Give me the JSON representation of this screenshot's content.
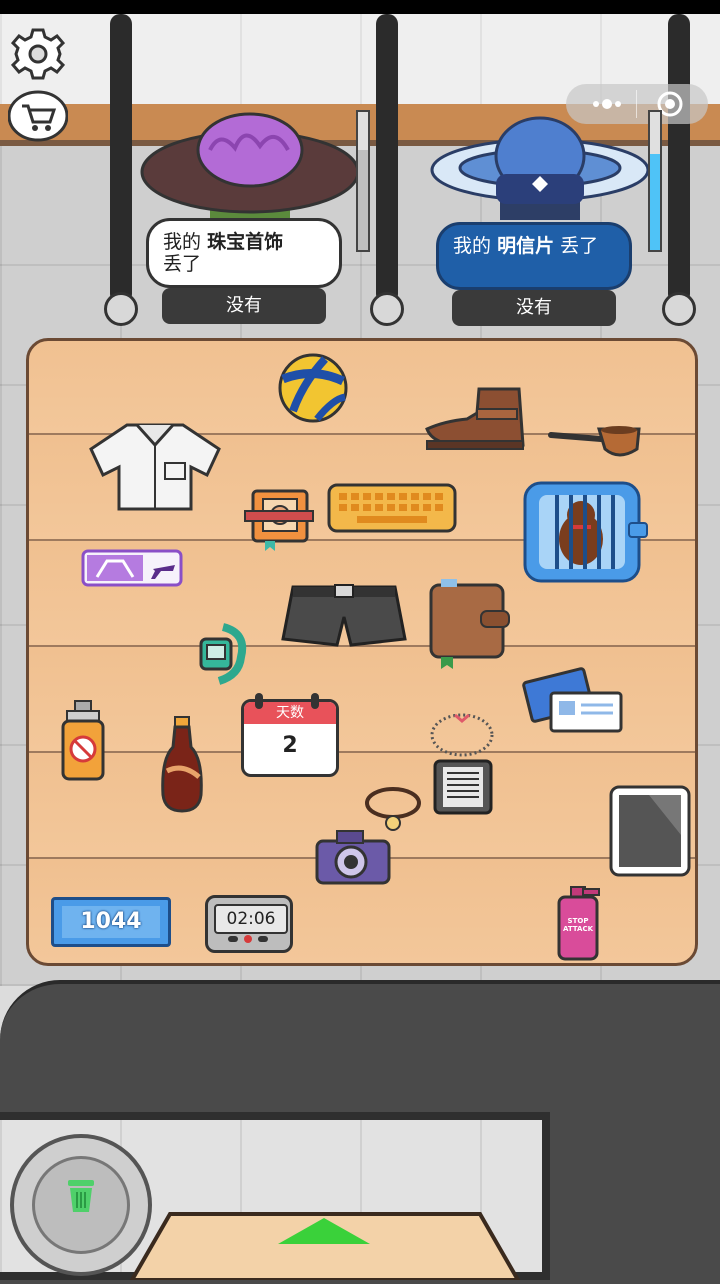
{
  "hud": {
    "settings_icon": "gear-icon",
    "shop_icon": "cart-icon",
    "menu_icon": "more-dots-icon",
    "close_icon": "target-circle-icon"
  },
  "customers": [
    {
      "request_prefix": "我的",
      "request_item": "珠宝首饰",
      "request_suffix": "丢了",
      "answer_label": "没有"
    },
    {
      "request_prefix": "我的",
      "request_item": "明信片",
      "request_suffix": "丢了",
      "answer_label": "没有"
    }
  ],
  "calendar": {
    "header": "天数",
    "day": "2"
  },
  "score": "1044",
  "timer": "02:06",
  "spray_can_label": "STOP ATTACK",
  "colors": {
    "table_wood": "#f3c79a",
    "bubble_blue": "#1f5fa8",
    "accent_green": "#3ad13a"
  }
}
